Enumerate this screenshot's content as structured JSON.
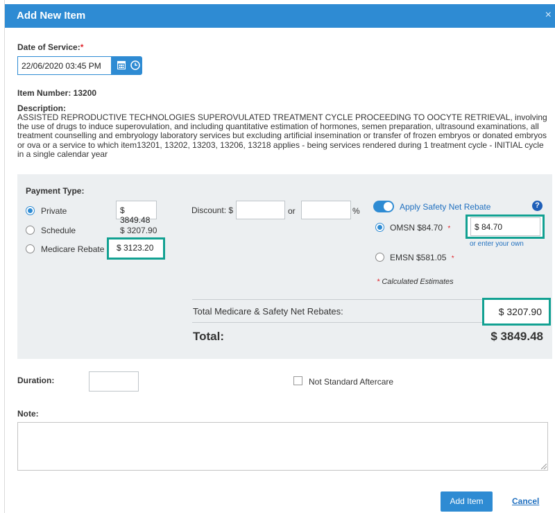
{
  "dialog": {
    "title": "Add New Item",
    "close_icon": "×"
  },
  "date_of_service": {
    "label": "Date of Service:",
    "required_mark": "*",
    "value": "22/06/2020 03:45 PM"
  },
  "item": {
    "number_label": "Item Number: 13200",
    "description_label": "Description:",
    "description_lines": [
      "ASSISTED REPRODUCTIVE TECHNOLOGIES SUPEROVULATED TREATMENT CYCLE PROCEEDING TO OOCYTE RETRIEVAL, involving",
      "the use of drugs to induce superovulation, and including quantitative estimation of hormones, semen preparation, ultrasound examinations, all",
      "treatment counselling and embryology laboratory services but excluding artificial insemination or transfer of frozen embryos or donated embryos",
      "or ova or a service to which item13201, 13202, 13203, 13206, 13218 applies - being services rendered during 1 treatment cycle - INITIAL cycle",
      "in a single calendar year"
    ]
  },
  "payment": {
    "label": "Payment Type:",
    "options": [
      {
        "label": "Private",
        "value": "$ 3849.48",
        "selected": true
      },
      {
        "label": "Schedule",
        "value": "$ 3207.90",
        "selected": false
      },
      {
        "label": "Medicare Rebate",
        "value": "$ 3123.20",
        "selected": false
      }
    ],
    "discount_label": "Discount: $",
    "discount_value": "",
    "or_label": "or",
    "percent_value": "",
    "percent_label": "%"
  },
  "safety_net": {
    "toggle_label": "Apply Safety Net Rebate",
    "toggle_on": true,
    "help_icon": "?",
    "omsn_label": "OMSN $84.70",
    "omsn_value": "$ 84.70",
    "omsn_selected": true,
    "enter_own": "or enter your own",
    "emsn_label": "EMSN $581.05",
    "required_mark": "*",
    "estimates_note": "Calculated Estimates"
  },
  "totals": {
    "rebates_label": "Total Medicare & Safety Net Rebates:",
    "rebates_value": "$ 3207.90",
    "total_label": "Total:",
    "total_value": "$ 3849.48"
  },
  "duration": {
    "label": "Duration:",
    "value": ""
  },
  "aftercare": {
    "label": "Not Standard Aftercare",
    "checked": false
  },
  "note": {
    "label": "Note:",
    "value": ""
  },
  "actions": {
    "add_label": "Add Item",
    "cancel_label": "Cancel"
  },
  "colors": {
    "accent": "#2e8bd3",
    "highlight": "#12a192",
    "panel": "#eceff1",
    "required": "#e0242b"
  }
}
